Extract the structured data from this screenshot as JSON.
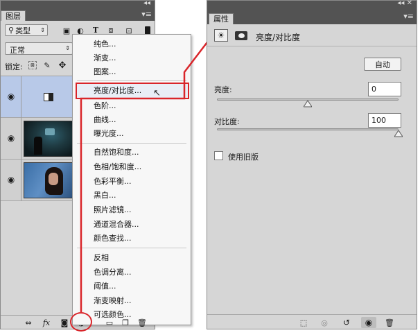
{
  "layers_panel": {
    "tab_label": "图层",
    "filter_label": "类型",
    "blend_mode": "正常",
    "lock_label": "锁定:",
    "filter_icons": [
      "image-filter-icon",
      "adjustment-filter-icon",
      "type-filter-icon",
      "shape-filter-icon",
      "smart-object-filter-icon"
    ],
    "layers": [
      {
        "name": "brightness-contrast-layer",
        "thumb": "adjustment"
      },
      {
        "name": "street-photo-layer",
        "thumb": "photo-street"
      },
      {
        "name": "portrait-photo-layer",
        "thumb": "photo-portrait"
      }
    ],
    "footer_icons": [
      "link-icon",
      "fx-icon",
      "mask-icon",
      "adjustment-icon",
      "group-icon",
      "new-layer-icon",
      "trash-icon"
    ]
  },
  "adjustment_menu": {
    "items": [
      {
        "label": "纯色..."
      },
      {
        "label": "渐变..."
      },
      {
        "label": "图案..."
      },
      {
        "label": "亮度/对比度...",
        "highlighted": true
      },
      {
        "label": "色阶..."
      },
      {
        "label": "曲线..."
      },
      {
        "label": "曝光度..."
      },
      {
        "label": "自然饱和度..."
      },
      {
        "label": "色相/饱和度..."
      },
      {
        "label": "色彩平衡..."
      },
      {
        "label": "黑白..."
      },
      {
        "label": "照片滤镜..."
      },
      {
        "label": "通道混合器..."
      },
      {
        "label": "颜色查找..."
      },
      {
        "label": "反相"
      },
      {
        "label": "色调分离..."
      },
      {
        "label": "阈值..."
      },
      {
        "label": "渐变映射..."
      },
      {
        "label": "可选颜色..."
      }
    ]
  },
  "properties_panel": {
    "tab_label": "属性",
    "title": "亮度/对比度",
    "auto_button": "自动",
    "brightness": {
      "label": "亮度:",
      "value": "0",
      "min": -150,
      "max": 150,
      "current": 0
    },
    "contrast": {
      "label": "对比度:",
      "value": "100",
      "min": -50,
      "max": 100,
      "current": 100
    },
    "legacy_label": "使用旧版",
    "legacy_checked": false,
    "footer_icons": [
      "clip-to-layer-icon",
      "view-previous-icon",
      "reset-icon",
      "visibility-icon",
      "trash-icon"
    ]
  },
  "colors": {
    "highlight": "#d9252a",
    "selected_layer": "#b8c9e8",
    "panel_bg": "#d6d6d6",
    "titlebar": "#535353"
  }
}
